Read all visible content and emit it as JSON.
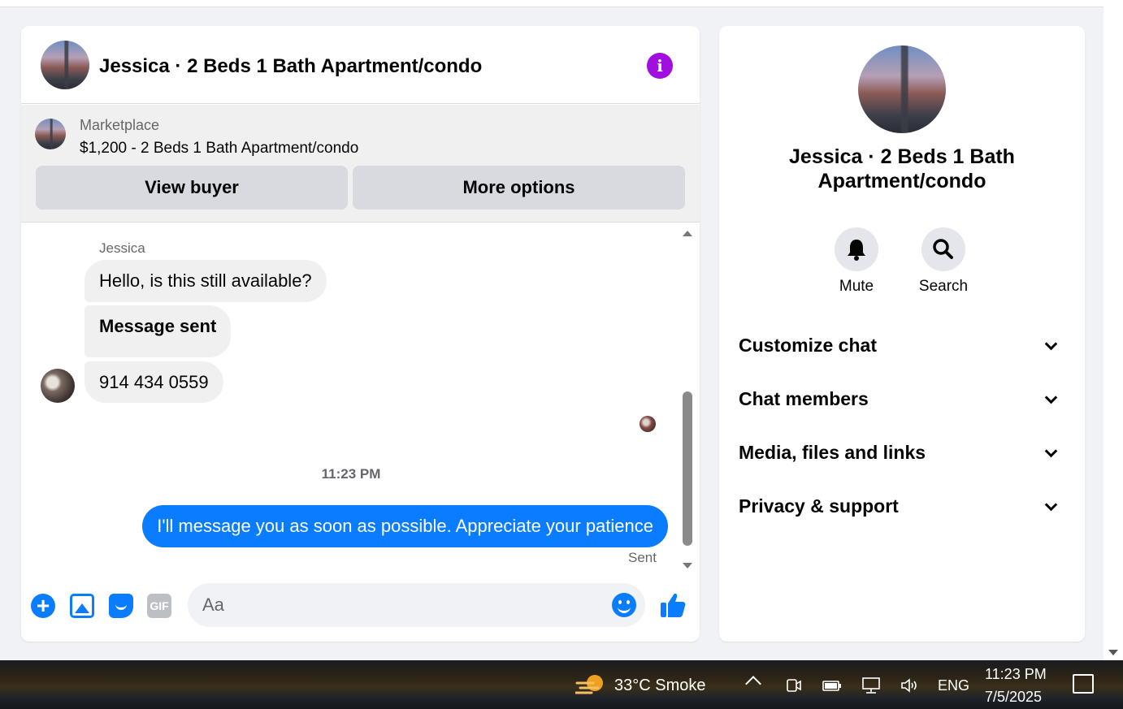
{
  "chat": {
    "title": "Jessica · 2 Beds 1 Bath Apartment/condo",
    "marketplace_label": "Marketplace",
    "listing": "$1,200 - 2 Beds 1 Bath Apartment/condo",
    "view_buyer_label": "View buyer",
    "more_options_label": "More options",
    "sender_name": "Jessica",
    "messages_in": [
      "Hello, is this still available?",
      "Message sent",
      "914 434 0559"
    ],
    "timestamp": "11:23 PM",
    "message_out": "I'll message you as soon as possible. Appreciate your patience",
    "sent_status": "Sent",
    "gif_label": "GIF",
    "input_placeholder": "Aa"
  },
  "info": {
    "title": "Jessica · 2 Beds 1 Bath Apartment/condo",
    "mute_label": "Mute",
    "search_label": "Search",
    "sections": [
      "Customize chat",
      "Chat members",
      "Media, files and links",
      "Privacy & support"
    ]
  },
  "taskbar": {
    "weather": "33°C  Smoke",
    "language": "ENG",
    "time": "11:23 PM",
    "date": "7/5/2025"
  },
  "colors": {
    "accent": "#0a7cff",
    "info_icon": "#a00fe0"
  },
  "icons": [
    "info-icon",
    "plus-icon",
    "photo-icon",
    "sticker-icon",
    "gif-icon",
    "emoji-icon",
    "like-icon",
    "bell-icon",
    "search-icon",
    "chevron-down-icon",
    "weather-icon",
    "notification-icon"
  ]
}
